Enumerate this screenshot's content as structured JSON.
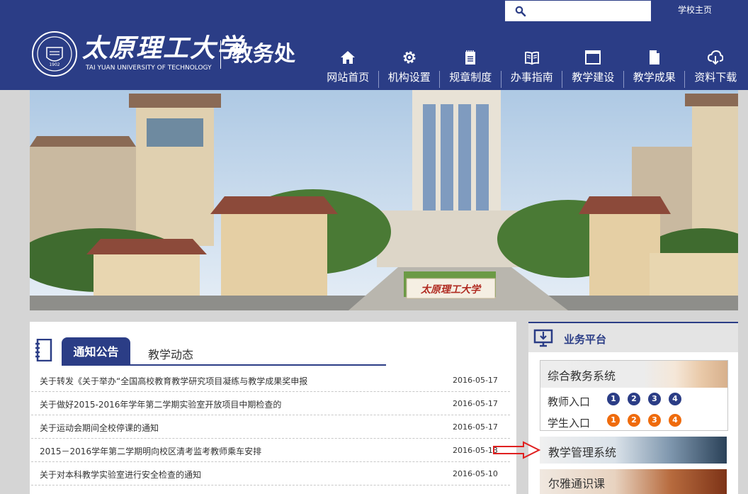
{
  "header": {
    "search": {
      "value": "",
      "placeholder": ""
    },
    "home_link": "学校主页",
    "logo": {
      "name_cn": "太原理工大学",
      "name_en": "TAI YUAN UNIVERSITY OF TECHNOLOGY",
      "seal_year": "1902",
      "office": "教务处"
    },
    "nav": [
      {
        "label": "网站首页",
        "icon": "home-icon"
      },
      {
        "label": "机构设置",
        "icon": "gear-icon"
      },
      {
        "label": "规章制度",
        "icon": "clipboard-icon"
      },
      {
        "label": "办事指南",
        "icon": "book-icon"
      },
      {
        "label": "教学建设",
        "icon": "window-icon"
      },
      {
        "label": "教学成果",
        "icon": "document-icon"
      },
      {
        "label": "资料下载",
        "icon": "cloud-download-icon"
      }
    ]
  },
  "banner": {
    "sign_text": "太原理工大学"
  },
  "notice": {
    "tabs": [
      "通知公告",
      "教学动态"
    ],
    "items": [
      {
        "title": "关于转发《关于举办“全国高校教育教学研究项目凝练与教学成果奖申报",
        "date": "2016-05-17"
      },
      {
        "title": "关于做好2015-2016年学年第二学期实验室开放项目中期检查的",
        "date": "2016-05-17"
      },
      {
        "title": "关于运动会期间全校停课的通知",
        "date": "2016-05-17"
      },
      {
        "title": "2015－2016学年第二学期明向校区清考监考教师乘车安排",
        "date": "2016-05-13"
      },
      {
        "title": "关于对本科教学实验室进行安全检查的通知",
        "date": "2016-05-10"
      }
    ]
  },
  "sidebar": {
    "title": "业务平台",
    "system_title": "综合教务系统",
    "teacher_label": "教师入口",
    "student_label": "学生入口",
    "teacher_entries": [
      "1",
      "2",
      "3",
      "4"
    ],
    "student_entries": [
      "1",
      "2",
      "3",
      "4"
    ],
    "teaching_mgmt": "教学管理系统",
    "erya": "尔雅通识课"
  },
  "colors": {
    "primary": "#2b3d86",
    "accent_orange": "#ef6b0c",
    "arrow_red": "#e02020"
  }
}
